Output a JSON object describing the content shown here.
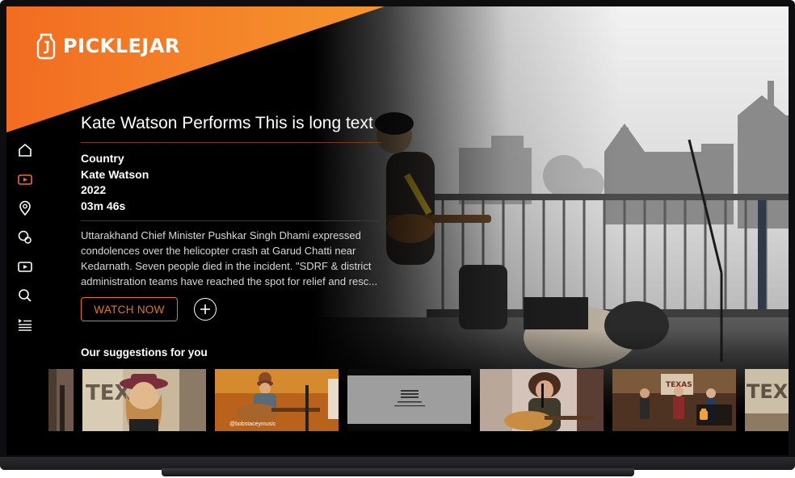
{
  "brand": {
    "name": "PICKLEJAR",
    "accent": "#f26c21"
  },
  "nav": {
    "items": [
      {
        "icon": "home-icon",
        "active": false
      },
      {
        "icon": "video-icon",
        "active": true
      },
      {
        "icon": "location-pin-icon",
        "active": false
      },
      {
        "icon": "genres-icon",
        "active": false
      },
      {
        "icon": "play-icon",
        "active": false
      },
      {
        "icon": "search-icon",
        "active": false
      },
      {
        "icon": "playlist-icon",
        "active": false
      }
    ]
  },
  "featured": {
    "title": "Kate Watson Performs This is long text",
    "genre": "Country",
    "artist": "Kate Watson",
    "year": "2022",
    "duration": "03m 46s",
    "description": "Uttarakhand Chief Minister Pushkar Singh Dhami expressed condolences over the helicopter crash at Garud Chatti near Kedarnath. Seven people died in the incident. \"SDRF & district administration teams have reached the spot for relief and rescue operations,\" he said.",
    "watch_label": "WATCH NOW"
  },
  "suggestions": {
    "heading": "Our suggestions for you",
    "items": [
      {
        "name": "suggestion-partial-left"
      },
      {
        "name": "suggestion-hat-singer"
      },
      {
        "name": "suggestion-guitarist-studio",
        "caption": "@bobstaceymusic"
      },
      {
        "name": "suggestion-logo-card"
      },
      {
        "name": "suggestion-curly-guitarist"
      },
      {
        "name": "suggestion-band-stage"
      },
      {
        "name": "suggestion-partial-right"
      }
    ]
  }
}
